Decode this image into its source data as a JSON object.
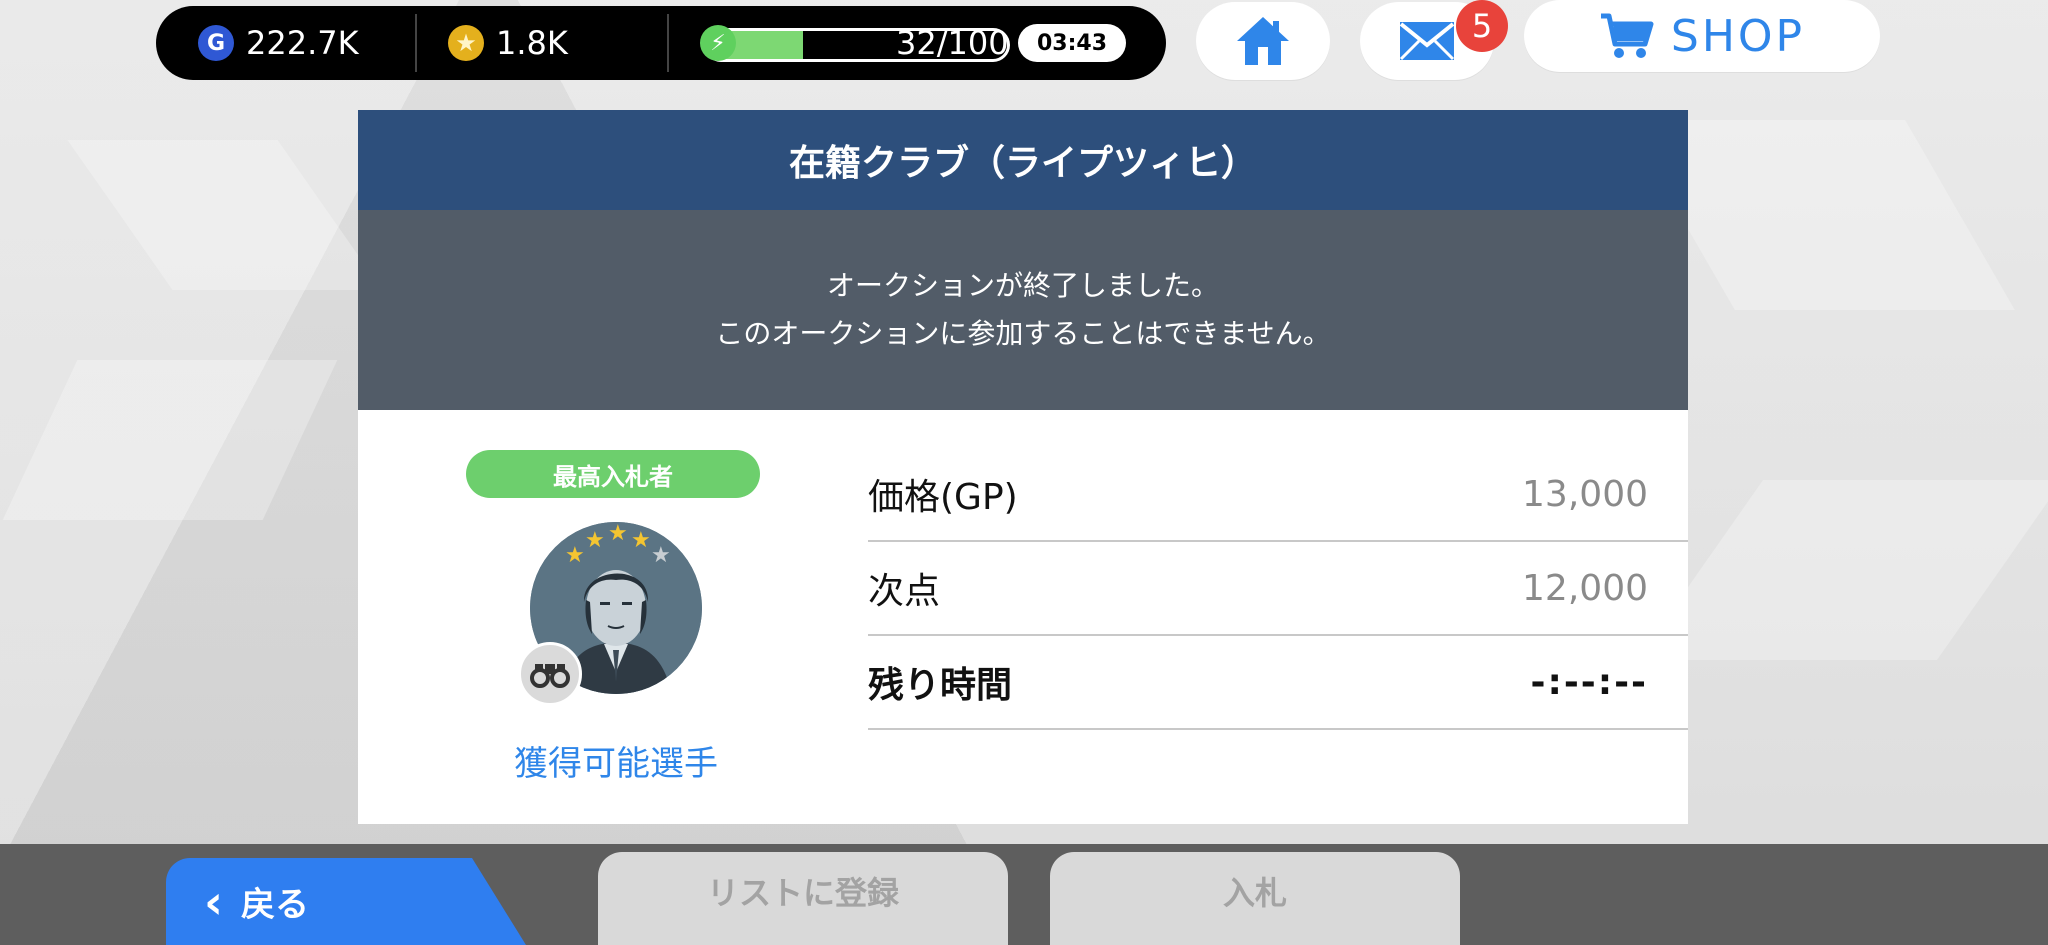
{
  "status": {
    "gp": "222.7K",
    "coins": "1.8K",
    "energy_text": "32/100",
    "energy_fraction": 0.32,
    "timer": "03:43"
  },
  "mail": {
    "badge_count": "5"
  },
  "shop": {
    "label": "SHOP"
  },
  "dialog": {
    "title": "在籍クラブ（ライプツィヒ）",
    "message_line1": "オークションが終了しました。",
    "message_line2": "このオークションに参加することはできません。",
    "bidder_label": "最高入札者",
    "player_link": "獲得可能選手",
    "rows": [
      {
        "label": "価格(GP)",
        "value": "13,000"
      },
      {
        "label": "次点",
        "value": "12,000"
      },
      {
        "label": "残り時間",
        "value": "-:--:--"
      }
    ]
  },
  "footer": {
    "back_label": "戻る",
    "list_label": "リストに登録",
    "bid_label": "入札"
  },
  "colors": {
    "header": "#2d4f7c",
    "message_bg": "#525c68",
    "accent_blue": "#2f7ef0",
    "bidder_green": "#6dcf6d",
    "badge_red": "#e8433b"
  },
  "icons": [
    "gp-coin-icon",
    "star-coin-icon",
    "energy-icon",
    "home-icon",
    "mail-icon",
    "cart-icon",
    "binoculars-icon",
    "chevron-left-icon"
  ]
}
